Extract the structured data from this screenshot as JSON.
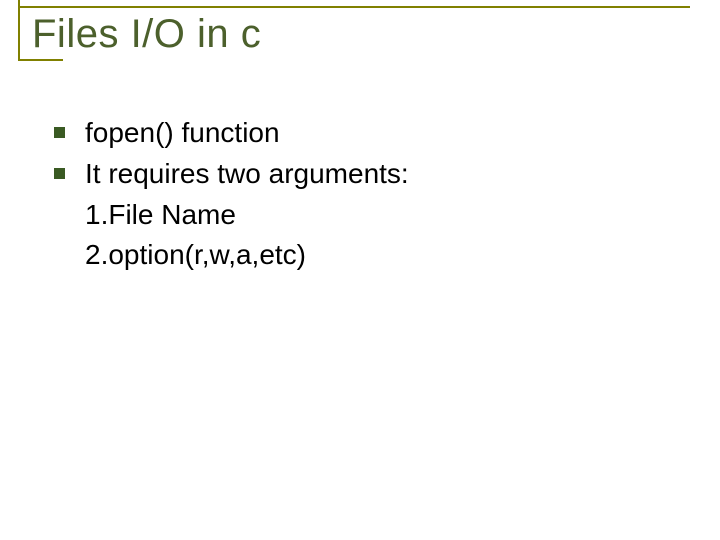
{
  "title": "Files I/O in c",
  "bullets": [
    "fopen() function",
    "It requires two arguments:"
  ],
  "sublines": [
    "1.File Name",
    "2.option(r,w,a,etc)"
  ]
}
